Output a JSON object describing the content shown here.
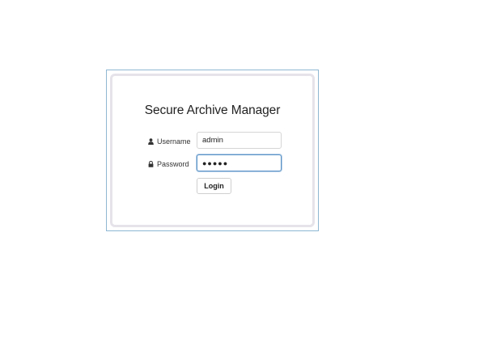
{
  "login": {
    "title": "Secure Archive Manager",
    "username_label": "Username",
    "password_label": "Password",
    "username_value": "admin",
    "password_masked": "●●●●●",
    "login_label": "Login"
  },
  "icons": {
    "username": "user-icon",
    "password": "lock-icon"
  },
  "colors": {
    "focus_border": "#5a93c7",
    "frame_border": "#8fb7d3"
  }
}
